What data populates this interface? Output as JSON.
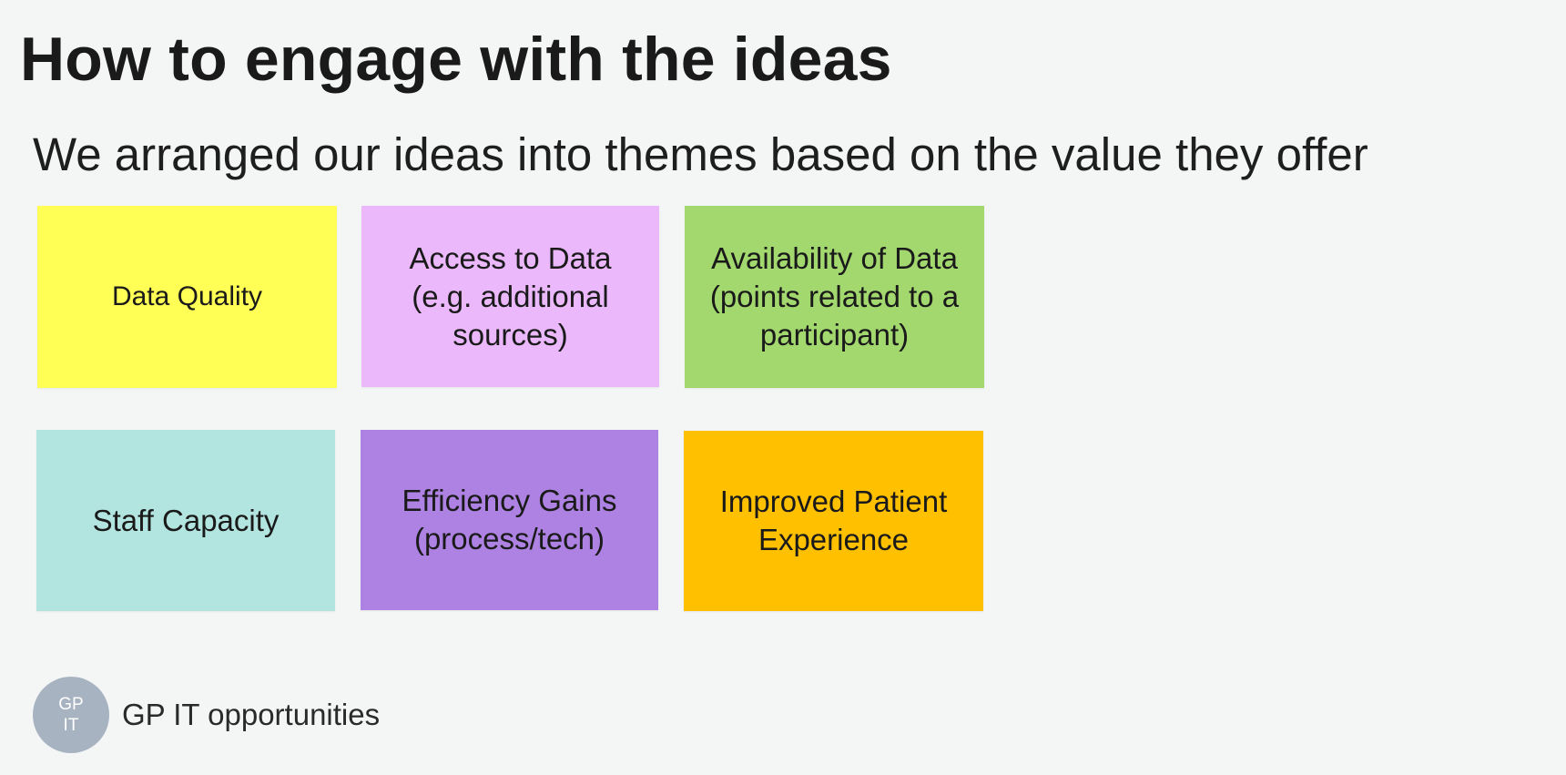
{
  "slide": {
    "title": "How to engage with the ideas",
    "subtitle": "We arranged our ideas into themes based on the value they offer"
  },
  "themes": [
    {
      "label": "Data Quality",
      "color": "#ffff55"
    },
    {
      "label": "Access to Data\n(e.g. additional\nsources)",
      "color": "#ebb9fb"
    },
    {
      "label": "Availability of Data\n(points related to a\nparticipant)",
      "color": "#a3d86f"
    },
    {
      "label": "Staff Capacity",
      "color": "#b3e5e0"
    },
    {
      "label": "Efficiency Gains\n(process/tech)",
      "color": "#ae82e2"
    },
    {
      "label": "Improved Patient\nExperience",
      "color": "#ffc000"
    }
  ],
  "footer": {
    "avatar_text": "GP\nIT",
    "label": "GP IT opportunities"
  }
}
